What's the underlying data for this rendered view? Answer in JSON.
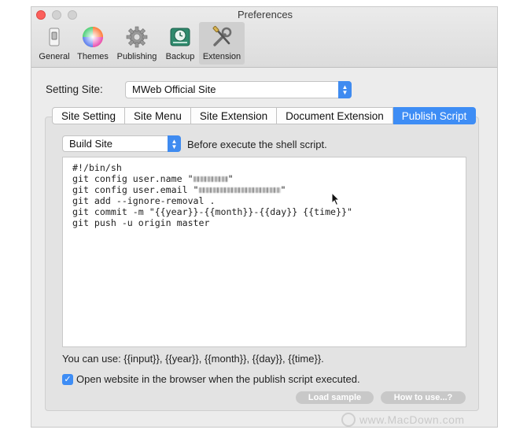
{
  "window": {
    "title": "Preferences"
  },
  "toolbar": [
    {
      "label": "General",
      "icon": "general-switch-icon"
    },
    {
      "label": "Themes",
      "icon": "color-wheel-icon"
    },
    {
      "label": "Publishing",
      "icon": "gear-icon"
    },
    {
      "label": "Backup",
      "icon": "time-machine-icon"
    },
    {
      "label": "Extension",
      "icon": "tools-icon",
      "selected": true
    }
  ],
  "setting_site": {
    "label": "Setting Site:",
    "value": "MWeb Official Site"
  },
  "tabs": [
    {
      "label": "Site Setting"
    },
    {
      "label": "Site Menu"
    },
    {
      "label": "Site Extension"
    },
    {
      "label": "Document Extension"
    },
    {
      "label": "Publish Script",
      "selected": true
    }
  ],
  "script": {
    "trigger_value": "Build Site",
    "trigger_hint": "Before execute the shell script.",
    "lines": [
      "#!/bin/sh",
      "",
      "git config user.name \"",
      "git config user.email \"",
      "git add --ignore-removal .",
      "git commit -m \"{{year}}-{{month}}-{{day}} {{time}}\"",
      "git push -u origin master"
    ]
  },
  "usage_hint": "You can use: {{input}}, {{year}}, {{month}}, {{day}}, {{time}}.",
  "open_website": {
    "label": "Open website in the browser when the publish script executed.",
    "checked": true
  },
  "buttons": {
    "load_sample": "Load sample",
    "how_to_use": "How to use...?"
  },
  "watermark": "www.MacDown.com",
  "colors": {
    "accent": "#3e8df5",
    "close": "#fc605c"
  }
}
